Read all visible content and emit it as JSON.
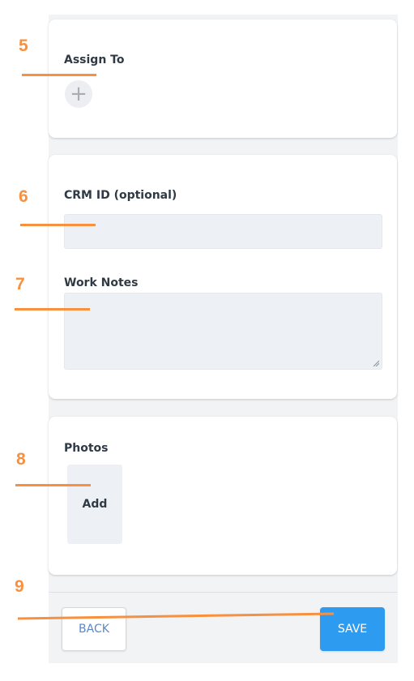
{
  "sections": {
    "assign": {
      "label": "Assign To",
      "add_icon": "+"
    },
    "crm": {
      "label": "CRM ID (optional)",
      "value": ""
    },
    "notes": {
      "label": "Work Notes",
      "value": ""
    },
    "photos": {
      "label": "Photos",
      "add_label": "Add"
    }
  },
  "footer": {
    "back_label": "BACK",
    "save_label": "SAVE"
  },
  "annotations": {
    "color": "#f7903f",
    "markers": [
      "5",
      "6",
      "7",
      "8",
      "9"
    ]
  },
  "colors": {
    "primary": "#2d9cf0",
    "field_bg": "#edf1f5",
    "back_text": "#5e86c7"
  }
}
